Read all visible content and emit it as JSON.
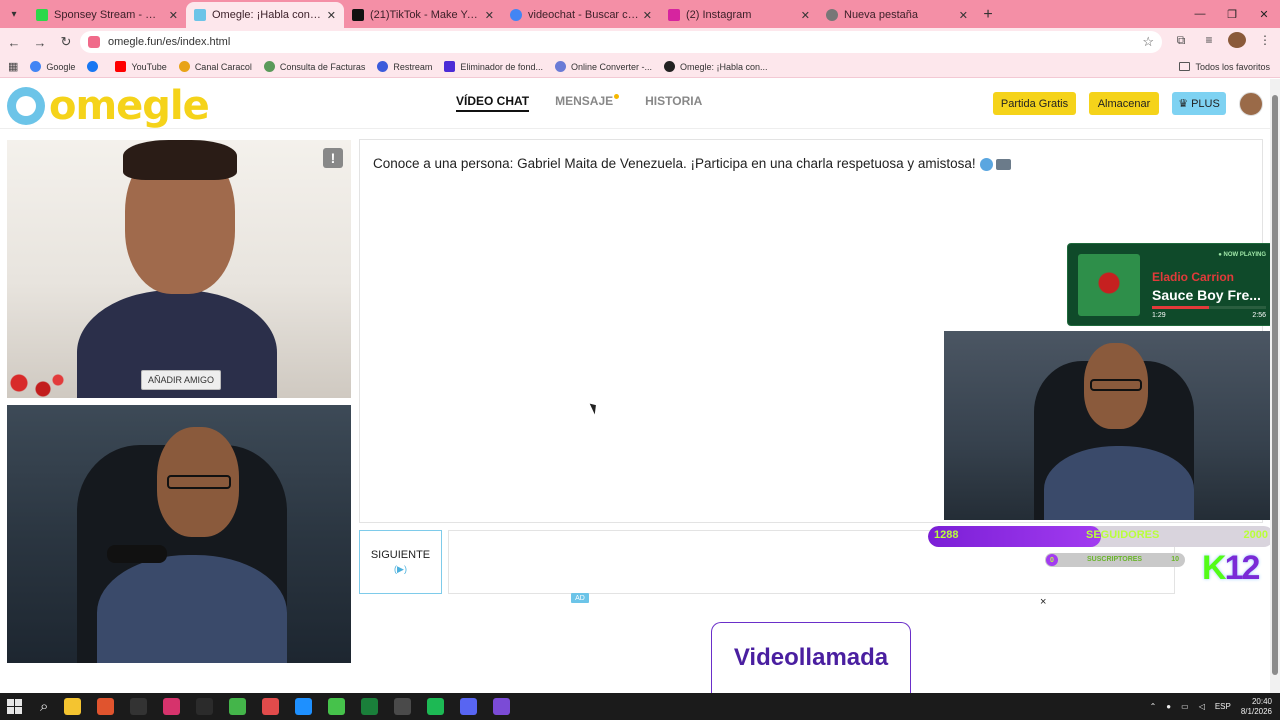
{
  "browser": {
    "tabs": [
      {
        "title": "Sponsey Stream - Watch Live o",
        "favicon_color": "#2bd84a",
        "active": false
      },
      {
        "title": "Omegle: ¡Habla con Descor",
        "favicon_color": "#6cc4e8",
        "active": true
      },
      {
        "title": "(21)TikTok - Make Your Day",
        "favicon_color": "#111111",
        "active": false
      },
      {
        "title": "videochat - Buscar con Google",
        "favicon_color": "#4285f4",
        "active": false
      },
      {
        "title": "(2) Instagram",
        "favicon_color": "#d6249f",
        "active": false
      },
      {
        "title": "Nueva pestaña",
        "favicon_color": "#777777",
        "active": false
      }
    ],
    "url": "omegle.fun/es/index.html",
    "bookmarks": [
      {
        "label": "Google",
        "color": "#4285f4"
      },
      {
        "label": "",
        "color": "#1877f2"
      },
      {
        "label": "YouTube",
        "color": "#ff0000"
      },
      {
        "label": "Canal Caracol",
        "color": "#e8a317"
      },
      {
        "label": "Consulta de Facturas",
        "color": "#5a9a5a"
      },
      {
        "label": "Restream",
        "color": "#3b5bdb"
      },
      {
        "label": "Eliminador de fond...",
        "color": "#4b2bd6"
      },
      {
        "label": "Online Converter -...",
        "color": "#6a7bd6"
      },
      {
        "label": "Omegle: ¡Habla con...",
        "color": "#222222"
      }
    ],
    "bookmarks_all": "Todos los favoritos"
  },
  "site": {
    "logo_text": "omegle",
    "nav": {
      "video_chat": "VÍDEO CHAT",
      "message": "MENSAJE",
      "history": "HISTORIA"
    },
    "buttons": {
      "free_game": "Partida Gratis",
      "store": "Almacenar",
      "plus": "PLUS"
    }
  },
  "video": {
    "add_friend": "AÑADIR AMIGO",
    "report": "!"
  },
  "chat": {
    "intro": "Conoce a una persona: Gabriel Maita de Venezuela. ¡Participa en una charla respetuosa y amistosa!",
    "next_label": "SIGUIENTE",
    "next_sub": "(▶)"
  },
  "ad": {
    "tag": "AD",
    "close": "×",
    "banner_text": "Videollamada"
  },
  "overlay": {
    "now_playing_tag": "● NOW PLAYING",
    "artist": "Eladio Carrion",
    "title": "Sauce Boy Fre...",
    "time_elapsed": "1:29",
    "time_total": "2:56",
    "progress": 0.5,
    "followers_current": "1288",
    "followers_label": "SEGUIDORES",
    "followers_goal": "2000",
    "followers_progress": 0.5,
    "subs_current": "0",
    "subs_label": "SUSCRIPTORES",
    "subs_goal": "10",
    "kick_text": "K",
    "kick_num": "12"
  },
  "taskbar": {
    "apps": [
      "#f4c430",
      "#e0542e",
      "#333333",
      "#d6336c",
      "#2b2b2b",
      "#44b54a",
      "#e14b4b",
      "#1e90ff",
      "#46c24b",
      "#1a7f3a",
      "#4a4a4a",
      "#1db954",
      "#5865f2",
      "#7b4bd6"
    ],
    "lang": "ESP",
    "time": "20:40",
    "date": "8/1/2026"
  }
}
